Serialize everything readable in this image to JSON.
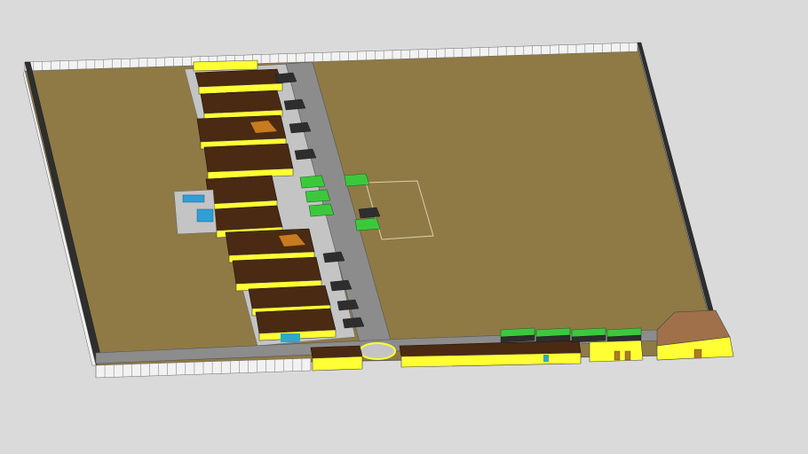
{
  "viewer": {
    "background_color": "#dadada"
  },
  "model": {
    "ground_color": "#8f7a45",
    "wall_color": "#f2f2f2",
    "wall_stroke": "#6a6a6a",
    "road_color": "#8c8c8c",
    "paving_color": "#c4c4c4",
    "building_wall_color": "#ffff33",
    "roof_color": "#4a2a12",
    "roof_accent_color": "#c87a20",
    "canopy_color": "#3cc83c",
    "pool_color": "#2f9fd8",
    "door_color": "#2fa8c8",
    "hall_roof_color": "#a0704a"
  }
}
